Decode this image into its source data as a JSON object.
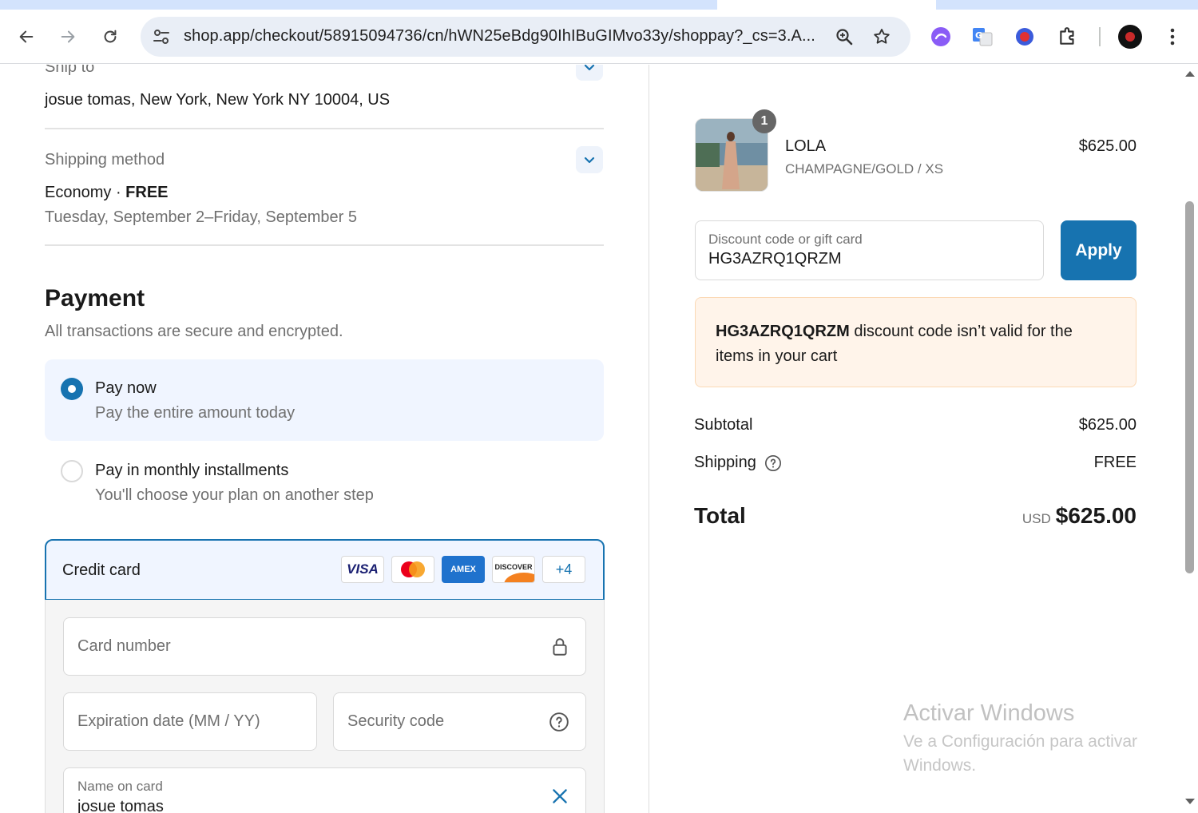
{
  "browser": {
    "url": "shop.app/checkout/58915094736/cn/hWN25eBdg90IhIBuGIMvo33y/shoppay?_cs=3.A..."
  },
  "shipping": {
    "ship_to_label": "Ship to",
    "address": "josue tomas, New York, New York NY 10004, US",
    "method_label": "Shipping method",
    "method_name": "Economy",
    "method_sep": "·",
    "method_price": "FREE",
    "method_dates": "Tuesday, September 2–Friday, September 5"
  },
  "payment": {
    "title": "Payment",
    "subtitle": "All transactions are secure and encrypted.",
    "options": [
      {
        "label": "Pay now",
        "desc": "Pay the entire amount today",
        "selected": true
      },
      {
        "label": "Pay in monthly installments",
        "desc": "You'll choose your plan on another step",
        "selected": false
      }
    ],
    "method_label": "Credit card",
    "card_brands": [
      "VISA",
      "AMEX",
      "DISCOVER"
    ],
    "more_brands": "+4",
    "card_number_placeholder": "Card number",
    "expiration_placeholder": "Expiration date (MM / YY)",
    "security_placeholder": "Security code",
    "name_label": "Name on card",
    "name_value": "josue tomas"
  },
  "summary": {
    "item": {
      "name": "LOLA",
      "variant": "CHAMPAGNE/GOLD / XS",
      "price": "$625.00",
      "quantity": "1"
    },
    "discount_label": "Discount code or gift card",
    "discount_value": "HG3AZRQ1QRZM",
    "apply_label": "Apply",
    "alert_code": "HG3AZRQ1QRZM",
    "alert_text": " discount code isn’t valid for the items in your cart",
    "subtotal_label": "Subtotal",
    "subtotal_value": "$625.00",
    "shipping_label": "Shipping",
    "shipping_value": "FREE",
    "total_label": "Total",
    "total_currency": "USD",
    "total_value": "$625.00"
  },
  "watermark": {
    "title": "Activar Windows",
    "subtitle": "Ve a Configuración para activar Windows."
  },
  "colors": {
    "accent": "#1773b0",
    "alert_bg": "#fff4ea",
    "selected_bg": "#f0f5ff"
  }
}
